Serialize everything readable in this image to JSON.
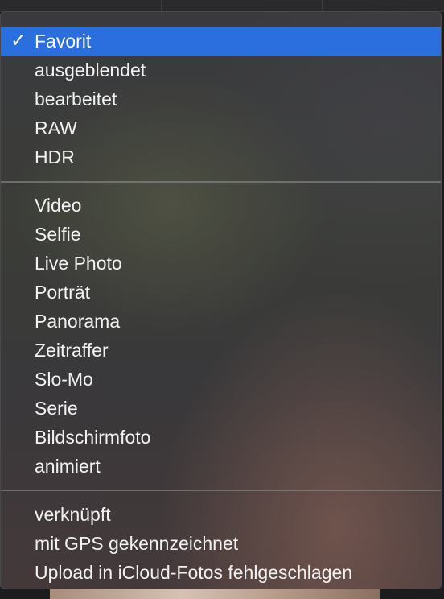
{
  "menu": {
    "group1": [
      {
        "label": "Favorit",
        "checked": true,
        "selected": true
      },
      {
        "label": "ausgeblendet"
      },
      {
        "label": "bearbeitet"
      },
      {
        "label": "RAW"
      },
      {
        "label": "HDR"
      }
    ],
    "group2": [
      {
        "label": "Video"
      },
      {
        "label": "Selfie"
      },
      {
        "label": "Live Photo"
      },
      {
        "label": "Porträt"
      },
      {
        "label": "Panorama"
      },
      {
        "label": "Zeitraffer"
      },
      {
        "label": "Slo-Mo"
      },
      {
        "label": "Serie"
      },
      {
        "label": "Bildschirmfoto"
      },
      {
        "label": "animiert"
      }
    ],
    "group3": [
      {
        "label": "verknüpft"
      },
      {
        "label": "mit GPS gekennzeichnet"
      },
      {
        "label": "Upload in iCloud-Fotos fehlgeschlagen"
      }
    ],
    "check_glyph": "✓",
    "accent_color": "#2b6fde"
  }
}
